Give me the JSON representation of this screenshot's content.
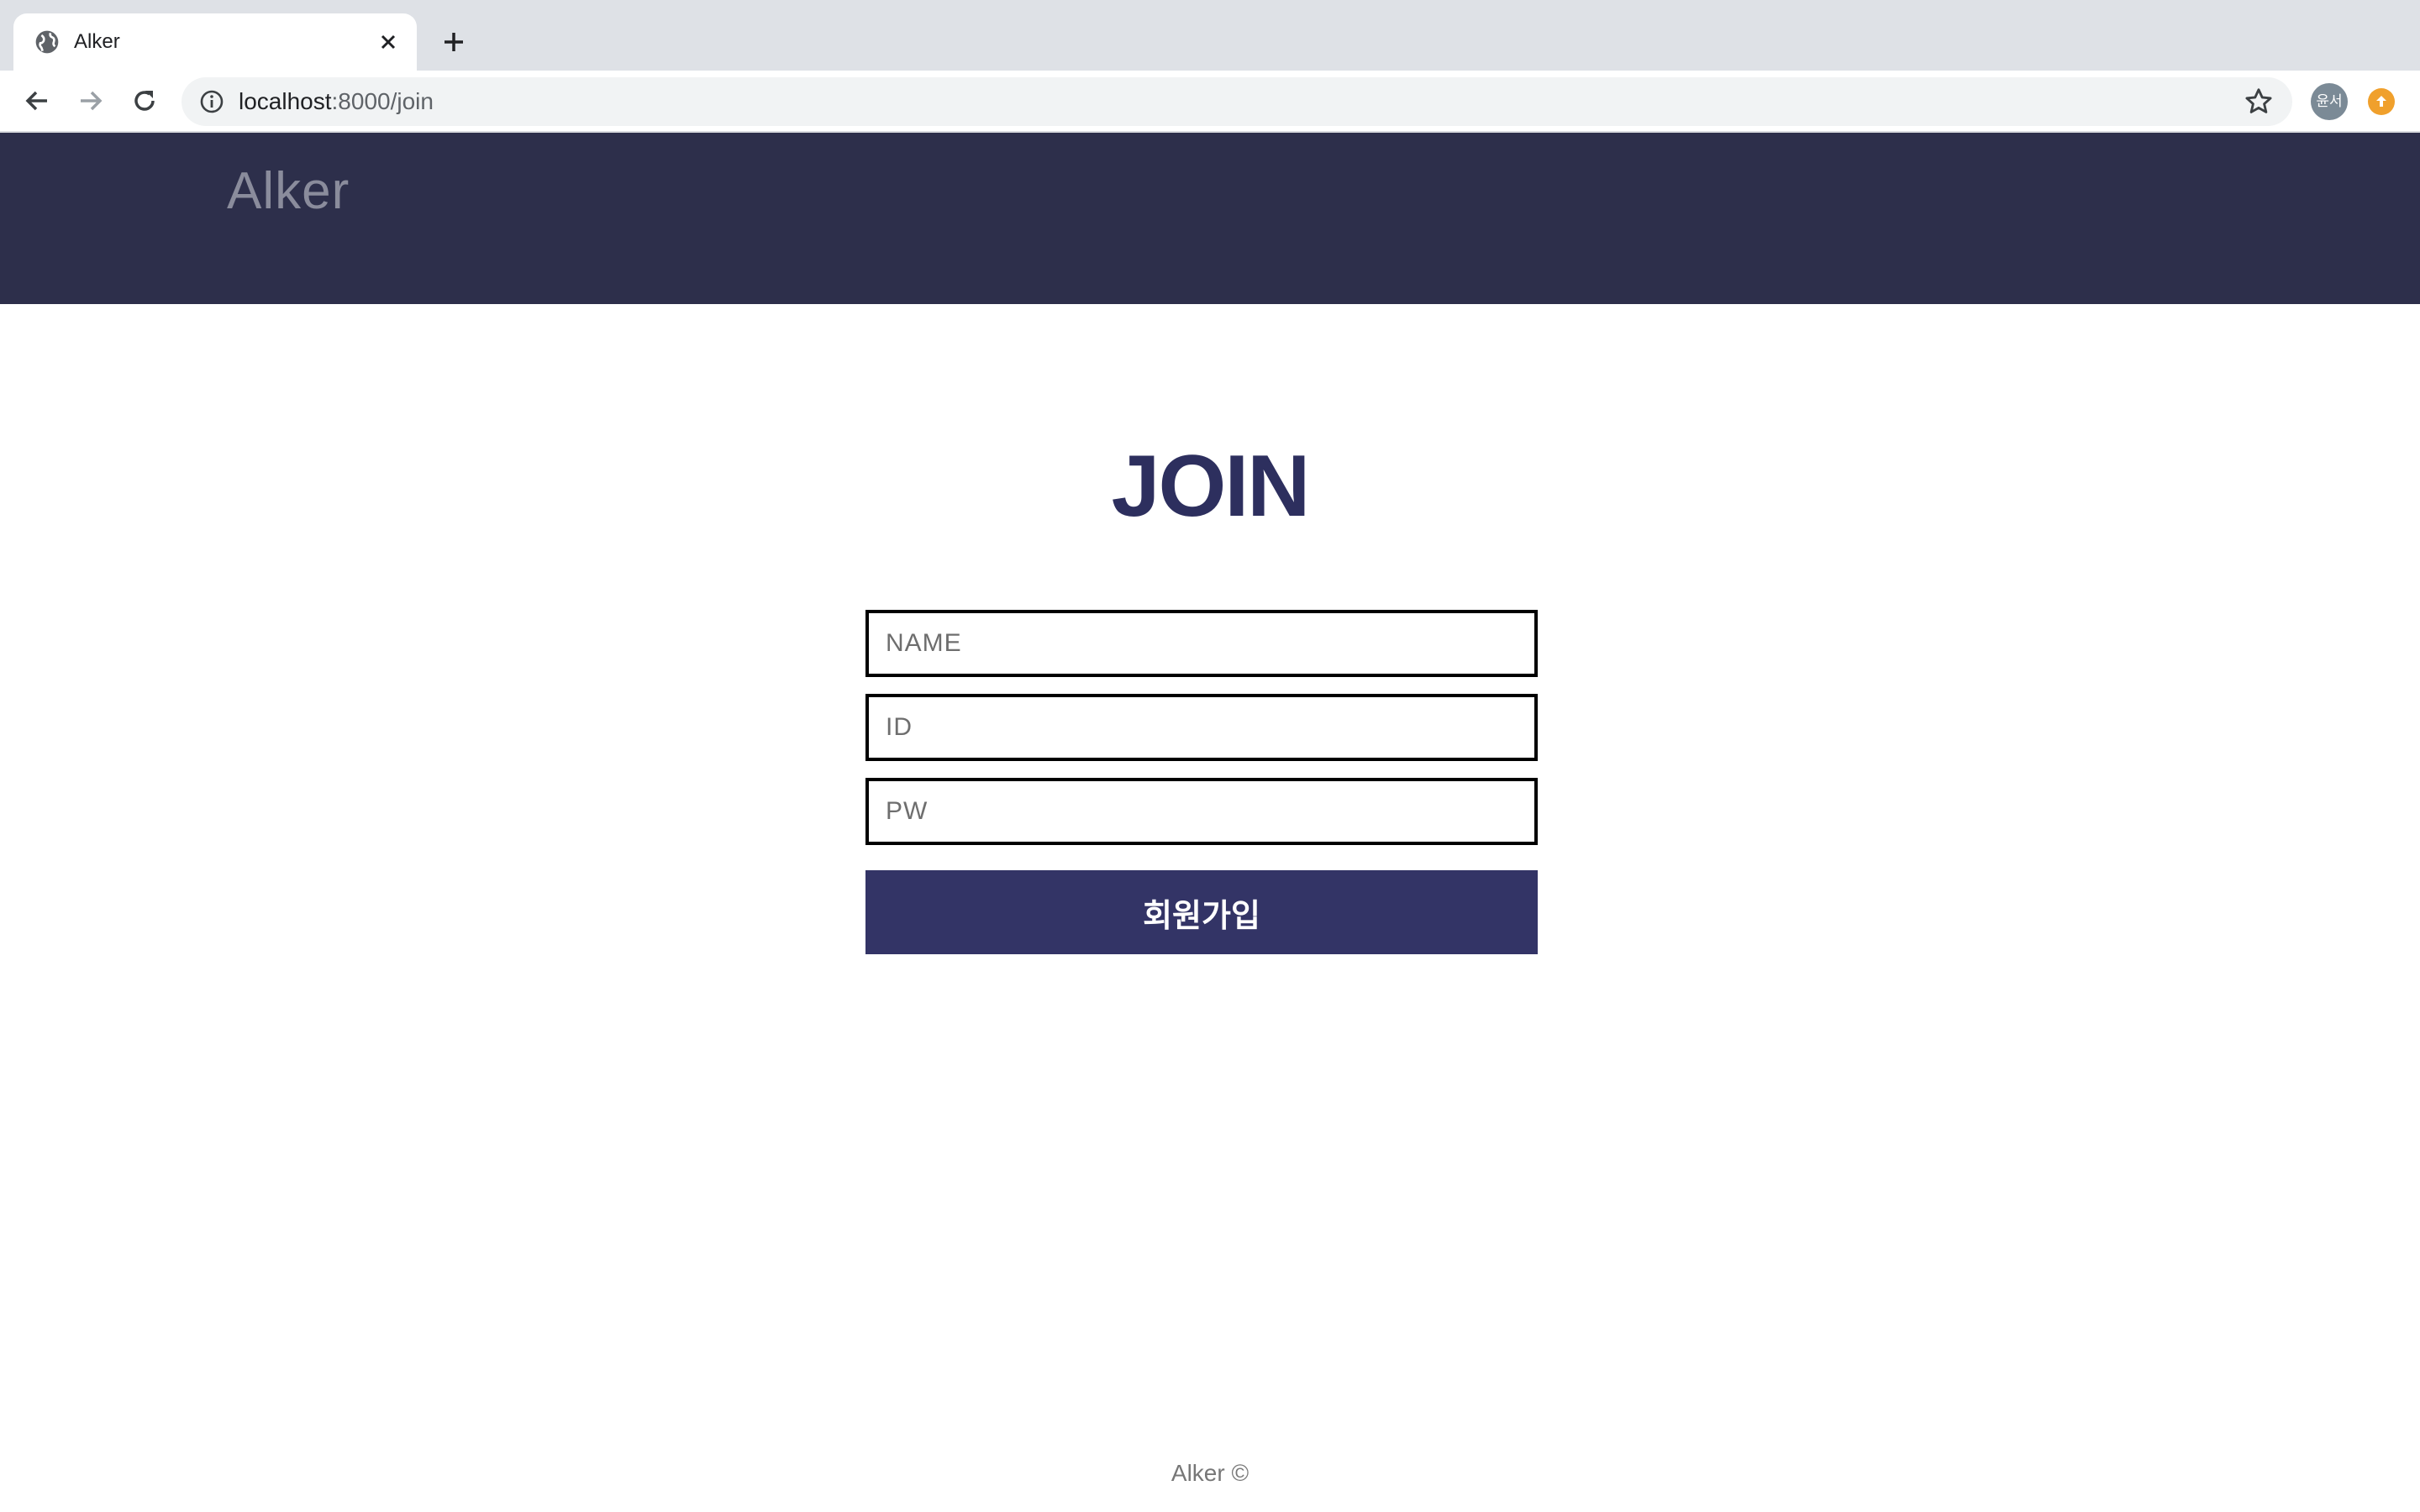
{
  "browser": {
    "tab_title": "Alker",
    "url_host": "localhost",
    "url_rest": ":8000/join",
    "profile_initials": "윤서"
  },
  "header": {
    "logo": "Alker",
    "background": "#2d2f4b"
  },
  "form": {
    "title": "JOIN",
    "name_placeholder": "NAME",
    "id_placeholder": "ID",
    "pw_placeholder": "PW",
    "submit_label": "회원가입",
    "button_color": "#333466"
  },
  "footer": {
    "text": "Alker ©"
  }
}
